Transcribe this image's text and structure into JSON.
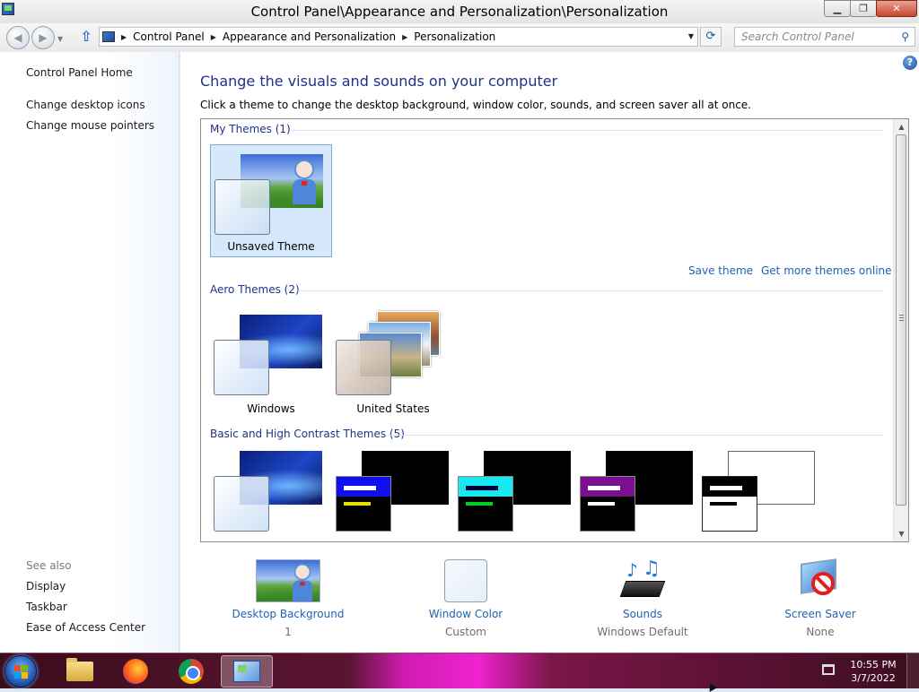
{
  "window": {
    "title": "Control Panel\\Appearance and Personalization\\Personalization",
    "minimize": "▭",
    "restore": "❐",
    "close": "✕"
  },
  "nav": {
    "breadcrumbs": [
      "Control Panel",
      "Appearance and Personalization",
      "Personalization"
    ],
    "search_placeholder": "Search Control Panel"
  },
  "sidebar": {
    "links": [
      "Control Panel Home",
      "Change desktop icons",
      "Change mouse pointers"
    ],
    "see_also_header": "See also",
    "see_also": [
      "Display",
      "Taskbar",
      "Ease of Access Center"
    ]
  },
  "main": {
    "title": "Change the visuals and sounds on your computer",
    "description": "Click a theme to change the desktop background, window color, sounds, and screen saver all at once.",
    "sections": {
      "my_themes": "My Themes (1)",
      "aero_themes": "Aero Themes (2)",
      "basic_themes": "Basic and High Contrast Themes (5)"
    },
    "themes": {
      "unsaved": "Unsaved Theme",
      "windows": "Windows",
      "united_states": "United States"
    },
    "links": {
      "save_theme": "Save theme",
      "get_more": "Get more themes online"
    },
    "help": "?"
  },
  "bottom": [
    {
      "label": "Desktop Background",
      "value": "1"
    },
    {
      "label": "Window Color",
      "value": "Custom"
    },
    {
      "label": "Sounds",
      "value": "Windows Default"
    },
    {
      "label": "Screen Saver",
      "value": "None"
    }
  ],
  "taskbar": {
    "time": "10:55 PM",
    "date": "3/7/2022"
  },
  "colors": {
    "accent_link": "#1f62b3",
    "heading": "#1e3287",
    "selection": "#d6e8fb"
  },
  "icons": [
    "back-arrow-icon",
    "forward-arrow-icon",
    "up-arrow-icon",
    "refresh-icon",
    "search-icon",
    "help-icon",
    "start-orb-icon",
    "file-explorer-icon",
    "firefox-icon",
    "chrome-icon",
    "control-panel-icon",
    "network-icon"
  ]
}
